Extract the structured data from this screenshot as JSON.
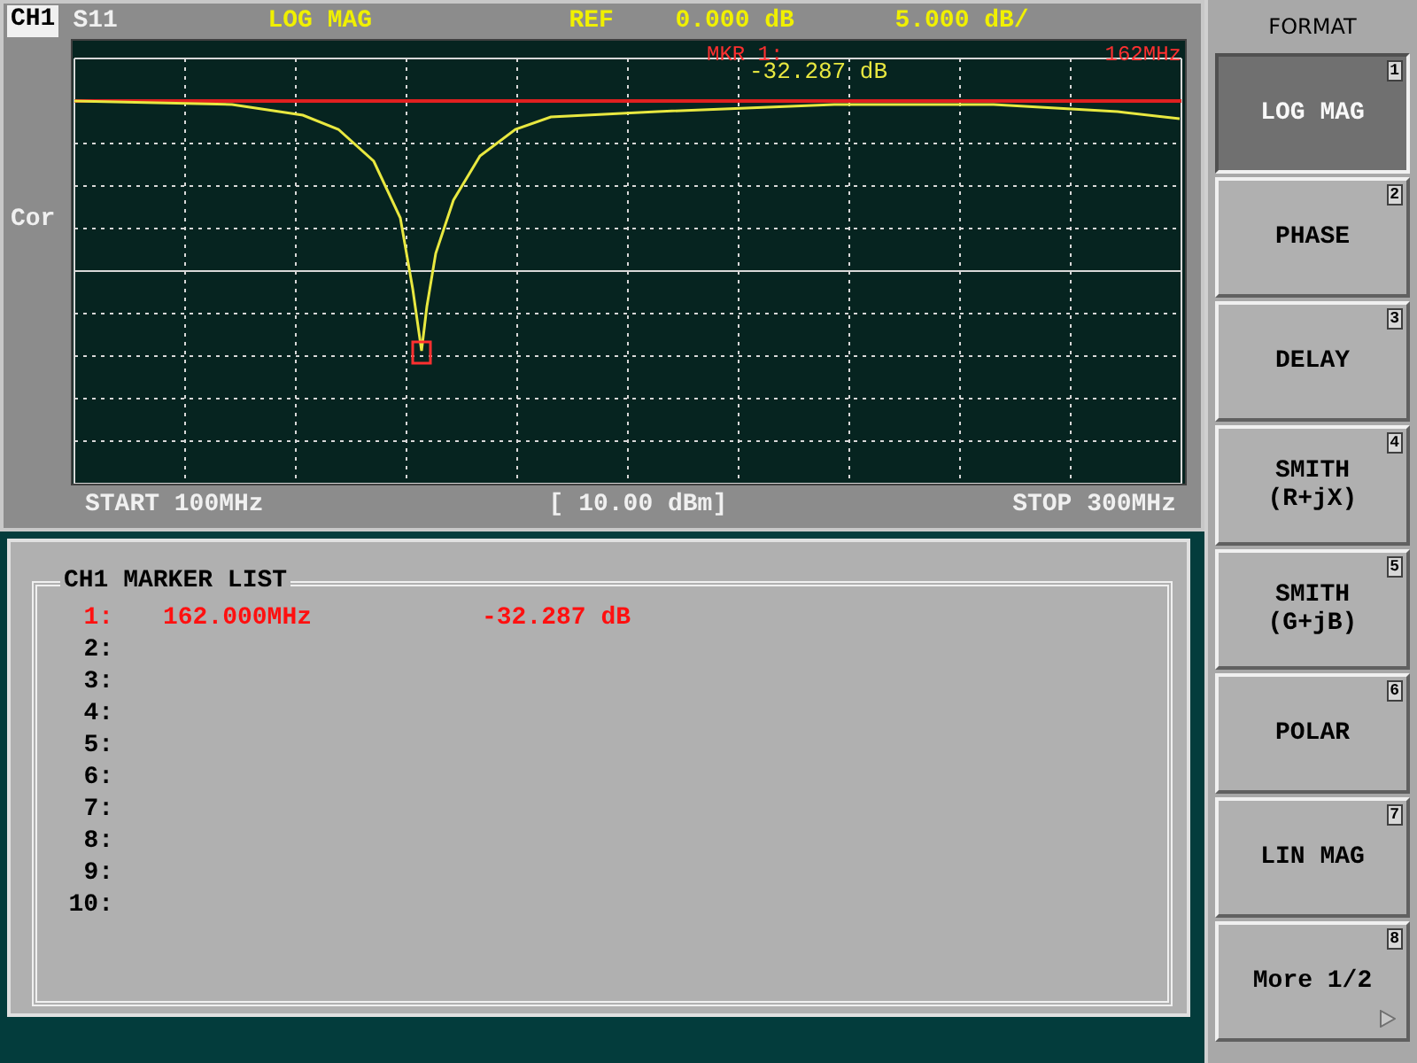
{
  "header": {
    "channel": "CH1",
    "parameter": "S11",
    "format": "LOG MAG",
    "ref_label": "REF",
    "ref_value": "0.000 dB",
    "scale": "5.000 dB/"
  },
  "plot": {
    "side_label": "Cor",
    "marker_label": "MKR 1:",
    "marker_frequency": "162MHz",
    "marker_value": "-32.287 dB"
  },
  "footer": {
    "start": "START 100MHz",
    "power": "[ 10.00 dBm]",
    "stop": "STOP 300MHz"
  },
  "marker_list": {
    "title": "CH1 MARKER LIST",
    "rows": [
      {
        "index": "1:",
        "frequency": "162.000MHz",
        "value": "-32.287 dB",
        "active": true
      },
      {
        "index": "2:",
        "active": false
      },
      {
        "index": "3:",
        "active": false
      },
      {
        "index": "4:",
        "active": false
      },
      {
        "index": "5:",
        "active": false
      },
      {
        "index": "6:",
        "active": false
      },
      {
        "index": "7:",
        "active": false
      },
      {
        "index": "8:",
        "active": false
      },
      {
        "index": "9:",
        "active": false
      },
      {
        "index": "10:",
        "active": false
      }
    ]
  },
  "softkeys": {
    "title": "FORMAT",
    "keys": [
      {
        "label": "LOG MAG",
        "number": "1",
        "selected": true,
        "submenu": false
      },
      {
        "label": "PHASE",
        "number": "2",
        "selected": false,
        "submenu": false
      },
      {
        "label": "DELAY",
        "number": "3",
        "selected": false,
        "submenu": false
      },
      {
        "label": "SMITH\n(R+jX)",
        "number": "4",
        "selected": false,
        "submenu": false
      },
      {
        "label": "SMITH\n(G+jB)",
        "number": "5",
        "selected": false,
        "submenu": false
      },
      {
        "label": "POLAR",
        "number": "6",
        "selected": false,
        "submenu": false
      },
      {
        "label": "LIN MAG",
        "number": "7",
        "selected": false,
        "submenu": false
      },
      {
        "label": "More 1/2",
        "number": "8",
        "selected": false,
        "submenu": true
      }
    ]
  }
}
